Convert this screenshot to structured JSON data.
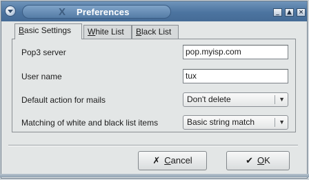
{
  "window": {
    "title": "Preferences",
    "title_icon": "X",
    "controls": {
      "minimize": "_",
      "maximize": "▲",
      "close": "×"
    }
  },
  "tabs": [
    {
      "prefix": "B",
      "rest": "asic Settings",
      "active": true
    },
    {
      "prefix": "W",
      "rest": "hite List",
      "active": false
    },
    {
      "prefix": "B",
      "rest": "lack List",
      "active": false
    }
  ],
  "settings": {
    "pop3_label": "Pop3 server",
    "pop3_value": "pop.myisp.com",
    "username_label": "User name",
    "username_value": "tux",
    "default_action_label": "Default action for mails",
    "default_action_value": "Don't delete",
    "matching_label": "Matching of white and black list items",
    "matching_value": "Basic string match"
  },
  "buttons": {
    "cancel": {
      "icon": "✗",
      "prefix": "C",
      "rest": "ancel"
    },
    "ok": {
      "icon": "✔",
      "prefix": "O",
      "rest": "K"
    }
  },
  "icons": {
    "window_menu": "window-menu-icon",
    "cancel": "cancel-icon",
    "ok": "ok-icon"
  }
}
